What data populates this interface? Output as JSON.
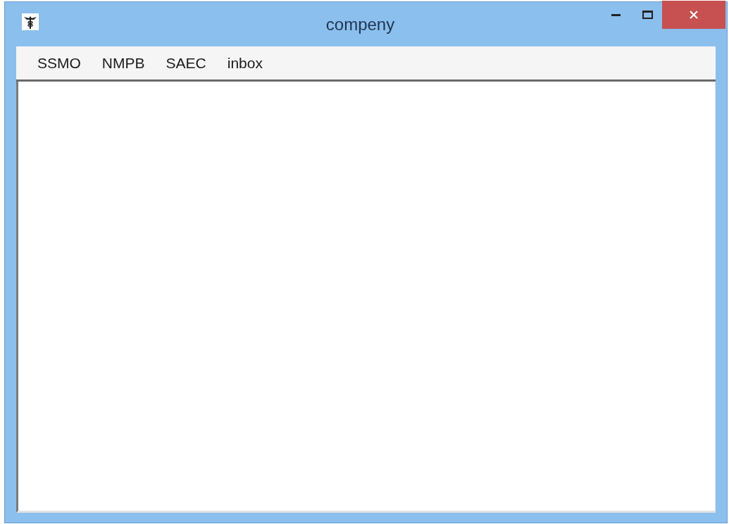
{
  "window": {
    "title": "compeny"
  },
  "menu": [
    "SSMO",
    "NMPB",
    "SAEC",
    "inbox"
  ]
}
